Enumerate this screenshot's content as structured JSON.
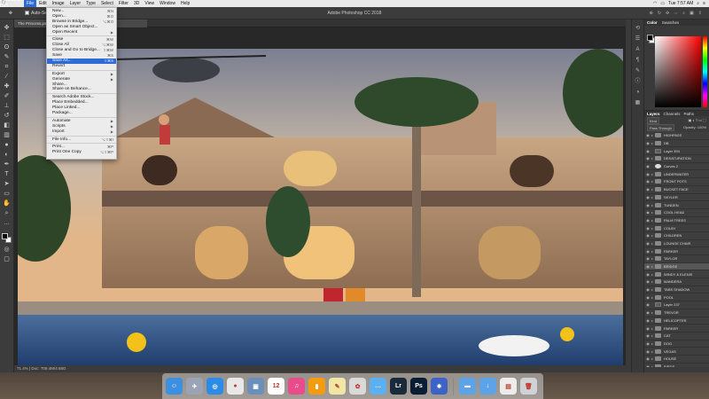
{
  "menubar": {
    "app": "Photoshop CC",
    "items": [
      "File",
      "Edit",
      "Image",
      "Layer",
      "Type",
      "Select",
      "Filter",
      "3D",
      "View",
      "Window",
      "Help"
    ],
    "clock": "Tue 7:57 AM"
  },
  "optbar": {
    "auto_select": "Auto-Select:",
    "window_title": "Adobe Photoshop CC 2018"
  },
  "doc_tab": "The Princess.psb @ 20.1% (Bridge, RGB/8)",
  "file_menu": [
    {
      "label": "New...",
      "shortcut": "⌘N"
    },
    {
      "label": "Open...",
      "shortcut": "⌘O"
    },
    {
      "label": "Browse in Bridge...",
      "shortcut": "⌥⌘O"
    },
    {
      "label": "Open as Smart Object..."
    },
    {
      "label": "Open Recent",
      "sub": true
    },
    {
      "sep": true
    },
    {
      "label": "Close",
      "shortcut": "⌘W"
    },
    {
      "label": "Close All",
      "shortcut": "⌥⌘W"
    },
    {
      "label": "Close and Go to Bridge...",
      "shortcut": "⇧⌘W"
    },
    {
      "label": "Save",
      "shortcut": "⌘S"
    },
    {
      "label": "Save As...",
      "shortcut": "⇧⌘S",
      "highlight": true
    },
    {
      "label": "Revert"
    },
    {
      "sep": true
    },
    {
      "label": "Export",
      "sub": true
    },
    {
      "label": "Generate",
      "sub": true
    },
    {
      "label": "Share..."
    },
    {
      "label": "Share on Behance..."
    },
    {
      "sep": true
    },
    {
      "label": "Search Adobe Stock..."
    },
    {
      "label": "Place Embedded..."
    },
    {
      "label": "Place Linked..."
    },
    {
      "label": "Package..."
    },
    {
      "sep": true
    },
    {
      "label": "Automate",
      "sub": true
    },
    {
      "label": "Scripts",
      "sub": true
    },
    {
      "label": "Import",
      "sub": true
    },
    {
      "sep": true
    },
    {
      "label": "File Info...",
      "shortcut": "⌥⇧⌘I"
    },
    {
      "sep": true
    },
    {
      "label": "Print...",
      "shortcut": "⌘P"
    },
    {
      "label": "Print One Copy",
      "shortcut": "⌥⇧⌘P"
    }
  ],
  "status": "71.4% | Doc: 709.4M/4.68G",
  "panels": {
    "color_tabs": [
      "Color",
      "Swatches"
    ],
    "layer_tabs": [
      "Layers",
      "Channels",
      "Paths"
    ],
    "kind": "Kind",
    "blend": "Pass Through",
    "opacity": "Opacity: 100%",
    "lock": "Lock:",
    "fill": "Fill: 100%"
  },
  "layers": [
    {
      "name": "HIGHPASS",
      "type": "folder"
    },
    {
      "name": "DB",
      "type": "folder"
    },
    {
      "name": "Layer 394",
      "type": "thumb"
    },
    {
      "name": "DESATURATION",
      "type": "folder"
    },
    {
      "name": "Curves 2",
      "type": "adj"
    },
    {
      "name": "UNDERWATER",
      "type": "folder"
    },
    {
      "name": "FRONT POTS",
      "type": "folder"
    },
    {
      "name": "BUCKET FACE",
      "type": "folder"
    },
    {
      "name": "SKYLER",
      "type": "folder"
    },
    {
      "name": "TUNDEN",
      "type": "folder"
    },
    {
      "name": "COOL HEAD",
      "type": "folder"
    },
    {
      "name": "PALM TREES",
      "type": "folder"
    },
    {
      "name": "COLBY",
      "type": "folder"
    },
    {
      "name": "CHILDREN",
      "type": "folder"
    },
    {
      "name": "LOUNGE CHAIR",
      "type": "folder"
    },
    {
      "name": "PARKER",
      "type": "folder"
    },
    {
      "name": "TAYLOR",
      "type": "folder"
    },
    {
      "name": "BRIDGE",
      "type": "folder",
      "selected": true
    },
    {
      "name": "WINDY & ELENIS",
      "type": "folder"
    },
    {
      "name": "MANDERA",
      "type": "folder"
    },
    {
      "name": "TABS SHADOW",
      "type": "folder"
    },
    {
      "name": "POOL",
      "type": "folder"
    },
    {
      "name": "Layer 237",
      "type": "thumb"
    },
    {
      "name": "TREVOR",
      "type": "folder"
    },
    {
      "name": "HELICOPTER",
      "type": "folder"
    },
    {
      "name": "PARKER",
      "type": "folder"
    },
    {
      "name": "CAT",
      "type": "folder"
    },
    {
      "name": "DOG",
      "type": "folder"
    },
    {
      "name": "VEGAS",
      "type": "folder"
    },
    {
      "name": "HOUSE",
      "type": "folder"
    },
    {
      "name": "BIRDS",
      "type": "folder"
    }
  ],
  "dock_apps": [
    {
      "name": "finder-app",
      "color": "#3d8fe0",
      "glyph": "☺"
    },
    {
      "name": "launchpad-app",
      "color": "#9aa4b4",
      "glyph": "✈"
    },
    {
      "name": "safari-app",
      "color": "#2b8be6",
      "glyph": "◎"
    },
    {
      "name": "chrome-app",
      "color": "#e8e8e8",
      "glyph": "●"
    },
    {
      "name": "preview-app",
      "color": "#6a8fb8",
      "glyph": "▣"
    },
    {
      "name": "calendar-app",
      "color": "#ffffff",
      "glyph": "12"
    },
    {
      "name": "itunes-app",
      "color": "#e84c8a",
      "glyph": "♫"
    },
    {
      "name": "ibooks-app",
      "color": "#f39c12",
      "glyph": "▮"
    },
    {
      "name": "notes-app",
      "color": "#f1e6a3",
      "glyph": "✎"
    },
    {
      "name": "photo-app",
      "color": "#d9d9d9",
      "glyph": "✿"
    },
    {
      "name": "messages-app",
      "color": "#5ab0f0",
      "glyph": "…"
    },
    {
      "name": "lightroom-app",
      "color": "#1b2a3a",
      "glyph": "Lr"
    },
    {
      "name": "photoshop-app",
      "color": "#0b1d33",
      "glyph": "Ps"
    },
    {
      "name": "capture-app",
      "color": "#3f62c6",
      "glyph": "✵"
    },
    {
      "name": "folder-app",
      "color": "#5da3e8",
      "glyph": "▬"
    },
    {
      "name": "downloads-app",
      "color": "#5da3e8",
      "glyph": "↓"
    },
    {
      "name": "screenshot-app",
      "color": "#ececec",
      "glyph": "▤"
    },
    {
      "name": "trash-app",
      "color": "#cfd3d6",
      "glyph": "🗑"
    }
  ]
}
